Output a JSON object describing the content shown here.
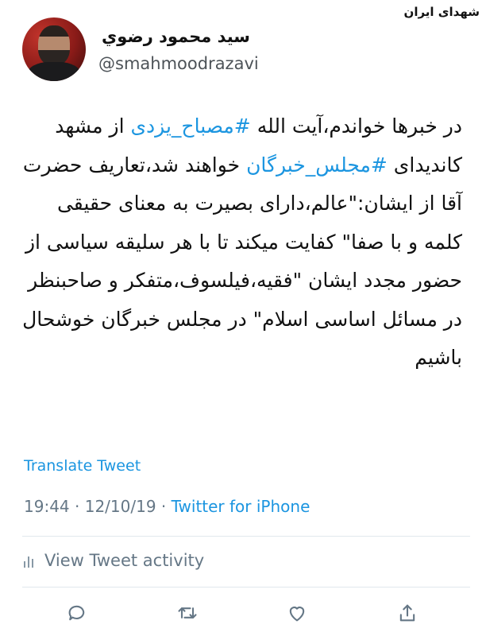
{
  "watermark": "شهدای ایران",
  "user": {
    "display_name": "سيد محمود رضوي",
    "handle": "@smahmoodrazavi"
  },
  "tweet": {
    "seg1": "در خبرها خواندم،آیت الله ",
    "hashtag1": "#مصباح_یزدی",
    "seg2": " از مشهد کاندیدای ",
    "hashtag2": "#مجلس_خبرگان",
    "seg3": " خواهند شد،تعاریف حضرت آقا از ایشان:\"عالم،دارای بصیرت به معنای حقیقی کلمه و با صفا\" کفایت میکند تا با هر سلیقه سیاسی از حضور مجدد ایشان \"فقیه،فیلسوف،متفکر و صاحبنظر در مسائل اساسی اسلام\" در مجلس خبرگان خوشحال باشیم"
  },
  "translate_label": "Translate Tweet",
  "meta": {
    "time": "19:44",
    "separator": " · ",
    "date": "12/10/19",
    "source": "Twitter for iPhone"
  },
  "activity_label": "View Tweet activity",
  "colors": {
    "link": "#1b95e0",
    "muted": "#657786",
    "divider": "#e1e8ed"
  },
  "icons": [
    "reply-icon",
    "retweet-icon",
    "like-icon",
    "share-icon",
    "analytics-bars-icon"
  ]
}
